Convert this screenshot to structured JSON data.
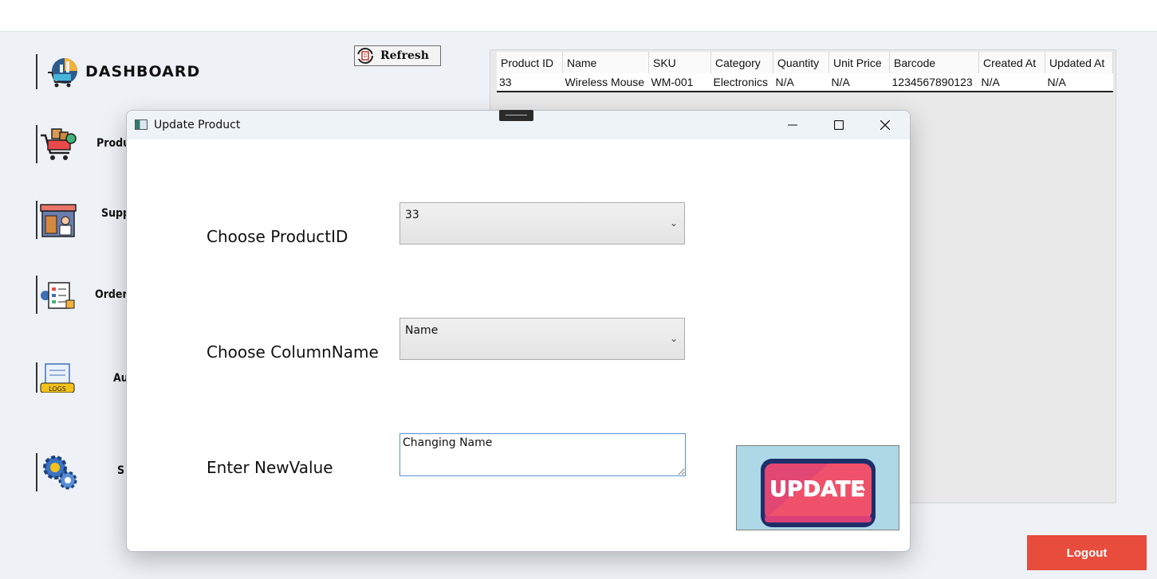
{
  "sidebar": {
    "title": "DASHBOARD",
    "items": [
      {
        "label": "Produ",
        "icon": "cart-products-icon"
      },
      {
        "label": "Suppl",
        "icon": "supplier-store-icon"
      },
      {
        "label": "Order",
        "icon": "order-checklist-icon"
      },
      {
        "label": "Au",
        "icon": "logs-icon"
      },
      {
        "label": "S",
        "icon": "settings-gears-icon"
      }
    ]
  },
  "toolbar": {
    "refresh_label": "Refresh"
  },
  "grid": {
    "columns": [
      "Product ID",
      "Name",
      "SKU",
      "Category",
      "Quantity",
      "Unit Price",
      "Barcode",
      "Created At",
      "Updated At"
    ],
    "rows": [
      [
        "33",
        "Wireless Mouse",
        "WM-001",
        "Electronics",
        "N/A",
        "N/A",
        "1234567890123",
        "N/A",
        "N/A"
      ]
    ]
  },
  "dialog": {
    "title": "Update Product",
    "product_id_label": "Choose ProductID",
    "product_id_value": "33",
    "column_label": "Choose ColumnName",
    "column_value": "Name",
    "new_value_label": "Enter NewValue",
    "new_value": "Changing Name",
    "update_button_text": "UPDATE"
  },
  "logout_label": "Logout",
  "colors": {
    "logout_bg": "#e74c3c",
    "update_bg": "#add8e6",
    "update_badge": "#f0516a",
    "update_border": "#1c2f6b"
  }
}
